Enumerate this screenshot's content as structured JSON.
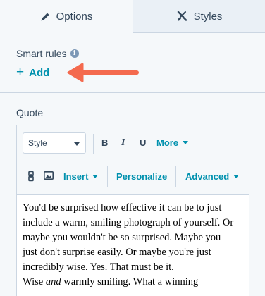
{
  "tabs": {
    "options_label": "Options",
    "styles_label": "Styles",
    "options_icon": "pencil-icon",
    "styles_icon": "paintbrush-icon"
  },
  "smart_rules": {
    "label": "Smart rules",
    "info_glyph": "i",
    "add_label": "Add",
    "add_glyph": "+"
  },
  "arrow": {
    "color": "#f46a4e",
    "icon": "annotation-arrow-icon"
  },
  "quote": {
    "label": "Quote",
    "toolbar": {
      "style_select_value": "Style",
      "bold_label": "B",
      "italic_label": "I",
      "underline_label": "U",
      "more_label": "More",
      "insert_label": "Insert",
      "personalize_label": "Personalize",
      "advanced_label": "Advanced",
      "link_icon": "link-icon",
      "image_icon": "image-icon"
    },
    "content": {
      "line1": "You'd be surprised how effective it can be to just",
      "line2": "include a warm, smiling photograph of yourself. Or",
      "line3": "maybe you wouldn't be so surprised. Maybe you",
      "line4": "just don't surprise easily. Or maybe you're just",
      "line5": "incredibly wise. Yes. That must be it.",
      "line6_pre": "Wise ",
      "line6_em": "and",
      "line6_post": " warmly smiling. What a winning"
    }
  },
  "colors": {
    "accent": "#0091ae",
    "text": "#33475b",
    "border": "#cbd6e2",
    "panel_bg": "#f5f8fa",
    "inactive_tab_bg": "#eaf0f6"
  }
}
